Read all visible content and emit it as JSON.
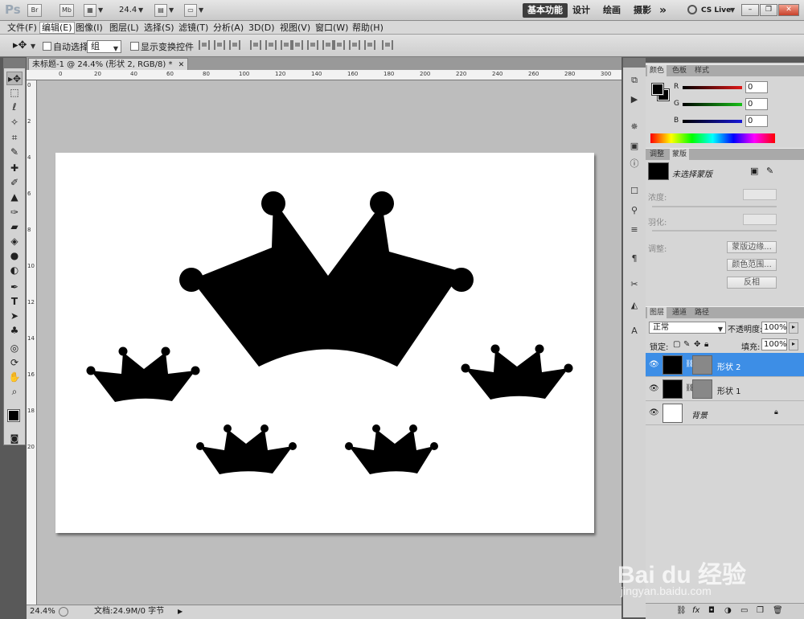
{
  "appbar": {
    "logo": "Ps",
    "btn_br": "Br",
    "btn_mb": "Mb",
    "zoom": "24.4",
    "workspaces": [
      "基本功能",
      "设计",
      "绘画",
      "摄影"
    ],
    "more": "»",
    "cslive": "CS Live"
  },
  "menu": [
    "文件(F)",
    "编辑(E)",
    "图像(I)",
    "图层(L)",
    "选择(S)",
    "滤镜(T)",
    "分析(A)",
    "3D(D)",
    "视图(V)",
    "窗口(W)",
    "帮助(H)"
  ],
  "options": {
    "auto_select": "自动选择:",
    "auto_select_value": "组",
    "show_transform": "显示变换控件"
  },
  "document": {
    "tab_title": "未标题-1 @ 24.4% (形状 2, RGB/8) *",
    "ruler_top": [
      "0",
      "20",
      "40",
      "60",
      "80",
      "100",
      "120",
      "140",
      "160",
      "180",
      "200",
      "220",
      "240",
      "260",
      "280",
      "300"
    ],
    "ruler_left": [
      "0",
      "2",
      "4",
      "6",
      "8",
      "10",
      "12",
      "14",
      "16",
      "18",
      "20"
    ]
  },
  "status": {
    "zoom": "24.4%",
    "doc": "文档:24.9M/0 字节"
  },
  "color_panel": {
    "tabs": [
      "颜色",
      "色板",
      "样式"
    ],
    "channels": [
      {
        "label": "R",
        "value": "0",
        "color": "#c81414"
      },
      {
        "label": "G",
        "value": "0",
        "color": "#14b414"
      },
      {
        "label": "B",
        "value": "0",
        "color": "#1414c8"
      }
    ]
  },
  "masks_panel": {
    "tabs": [
      "调整",
      "蒙版"
    ],
    "title": "未选择蒙版",
    "density": "浓度:",
    "feather": "羽化:",
    "refine": "调整:",
    "btn_edge": "蒙版边缘...",
    "btn_range": "颜色范围...",
    "btn_invert": "反相"
  },
  "layers_panel": {
    "tabs": [
      "图层",
      "通道",
      "路径"
    ],
    "blend_mode": "正常",
    "opacity_label": "不透明度:",
    "opacity": "100%",
    "lock_label": "锁定:",
    "fill_label": "填充:",
    "fill": "100%",
    "layers": [
      {
        "name": "形状 2",
        "selected": true
      },
      {
        "name": "形状 1",
        "selected": false
      },
      {
        "name": "背景",
        "selected": false
      }
    ]
  },
  "watermark": {
    "brand": "Bai du 经验",
    "url": "jingyan.baidu.com"
  },
  "colors": {
    "selected_layer": "#3d8ee6",
    "foreground": "#000000",
    "background": "#ffffff"
  }
}
